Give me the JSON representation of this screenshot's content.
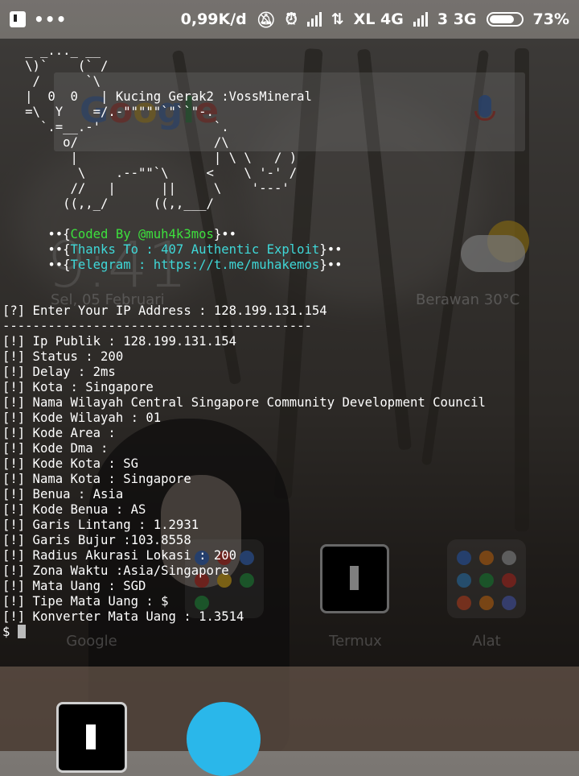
{
  "status_bar": {
    "speed": "0,99K/d",
    "carrier1": "XL 4G",
    "carrier2": "3 3G",
    "battery": "73%"
  },
  "home": {
    "google_logo": "Google",
    "clock": "9:41",
    "date": "Sel, 05 Februari",
    "weather": "Berawan  30°C",
    "labels": [
      "Google",
      "Termux",
      "Alat"
    ]
  },
  "terminal": {
    "banner": [
      "   _ _..._ __",
      "   \\)`    (` /",
      "    /      `\\",
      "   |  0  0   | Kucing Gerak2 :VossMineral",
      "   =\\  Y    =/.-\"\"\"\"\"`\"``\"-.",
      "     `.=__.-'               `.",
      "        o/                  /\\",
      "         |                  | \\ \\   / )",
      "          \\    .--\"\"`\\     <    \\ '-' /",
      "         //   |      ||     \\    '---'",
      "        ((,,_/      ((,,___/"
    ],
    "credits": [
      {
        "prefix": "      ••{",
        "text": "Coded By @muh4k3mos",
        "suffix": "}••"
      },
      {
        "prefix": "      ••{",
        "text": "Thanks To : 407 Authentic Exploit",
        "suffix": "}••"
      },
      {
        "prefix": "      ••{",
        "text": "Telegram : https://t.me/muhakemos",
        "suffix": "}••"
      }
    ],
    "prompt_line": "[?] Enter Your IP Address : 128.199.131.154",
    "separator": "-----------------------------------------",
    "results": [
      "[!] Ip Publik : 128.199.131.154",
      "[!] Status : 200",
      "[!] Delay : 2ms",
      "[!] Kota : Singapore",
      "[!] Nama Wilayah Central Singapore Community Development Council",
      "[!] Kode Wilayah : 01",
      "[!] Kode Area :",
      "[!] Kode Dma :",
      "[!] Kode Kota : SG",
      "[!] Nama Kota : Singapore",
      "[!] Benua : Asia",
      "[!] Kode Benua : AS",
      "[!] Garis Lintang : 1.2931",
      "[!] Garis Bujur :103.8558",
      "[!] Radius Akurasi Lokasi : 200",
      "[!] Zona Waktu :Asia/Singapore",
      "[!] Mata Uang : SGD",
      "[!] Tipe Mata Uang : $",
      "[!] Konverter Mata Uang : 1.3514"
    ],
    "shell_prompt": "$ "
  },
  "colors": {
    "accent_green": "#3de03d",
    "accent_cyan": "#3fd8d8",
    "terminal_text": "#ffffff"
  }
}
